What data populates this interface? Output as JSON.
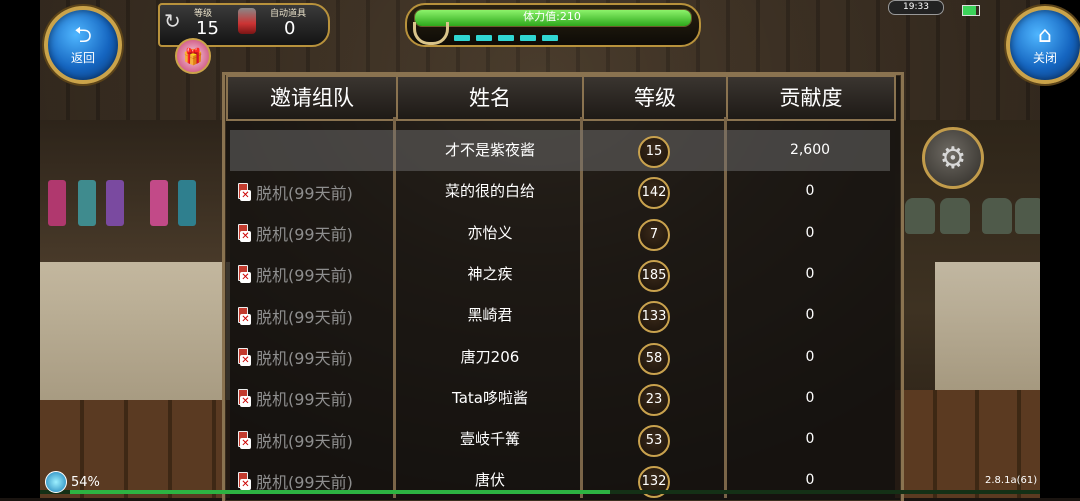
{
  "hud": {
    "back_icon": "back-arrow-icon",
    "back_label": "返回",
    "close_icon": "home-icon",
    "close_label": "关闭",
    "level_label": "等级",
    "level_value": "15",
    "auto_item_label": "自动道具",
    "auto_item_value": "0",
    "gift_icon": "gift-icon",
    "stamina_text": "体力值:210",
    "stamina_fraction": 1.0,
    "clock": "19:33",
    "settings_icon": "gear-icon"
  },
  "table": {
    "headers": [
      "邀请组队",
      "姓名",
      "等级",
      "贡献度"
    ],
    "rows": [
      {
        "invite": "",
        "name": "才不是紫夜酱",
        "level": "15",
        "contribution": "2,600",
        "highlighted": true
      },
      {
        "invite": "脱机(99天前)",
        "name": "菜的很的白给",
        "level": "142",
        "contribution": "0"
      },
      {
        "invite": "脱机(99天前)",
        "name": "亦怡义",
        "level": "7",
        "contribution": "0"
      },
      {
        "invite": "脱机(99天前)",
        "name": "神之疾",
        "level": "185",
        "contribution": "0"
      },
      {
        "invite": "脱机(99天前)",
        "name": "黑崎君",
        "level": "133",
        "contribution": "0"
      },
      {
        "invite": "脱机(99天前)",
        "name": "唐刀206",
        "level": "58",
        "contribution": "0"
      },
      {
        "invite": "脱机(99天前)",
        "name": "Tata哆啦酱",
        "level": "23",
        "contribution": "0"
      },
      {
        "invite": "脱机(99天前)",
        "name": "壹岐千篝",
        "level": "53",
        "contribution": "0"
      },
      {
        "invite": "脱机(99天前)",
        "name": "唐伏",
        "level": "132",
        "contribution": "0"
      }
    ]
  },
  "footer": {
    "load_percent": "54%",
    "version": "2.8.1a(61)"
  }
}
